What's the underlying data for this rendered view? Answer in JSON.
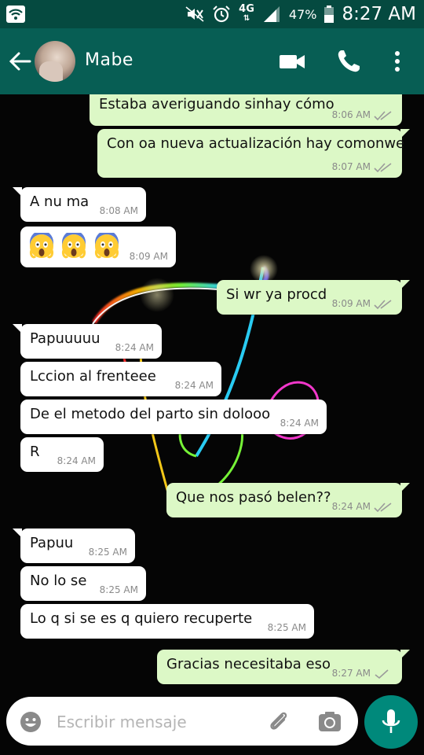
{
  "status_bar": {
    "network": "4G",
    "battery": "47%",
    "time": "8:27 AM"
  },
  "header": {
    "contact_name": "Mabe"
  },
  "messages": [
    {
      "direction": "out",
      "text": "Estaba averiguando sinhay cómo",
      "time": "8:06 AM",
      "status": "read"
    },
    {
      "direction": "out",
      "text": "Con oa nueva actualización hay comonwe",
      "time": "8:07 AM",
      "status": "read"
    },
    {
      "direction": "in",
      "text": "A nu ma",
      "time": "8:08 AM"
    },
    {
      "direction": "in",
      "emoji": [
        "face-screaming-in-fear",
        "face-screaming-in-fear",
        "face-screaming-in-fear"
      ],
      "time": "8:09 AM"
    },
    {
      "direction": "out",
      "text": "Si wr ya procd",
      "time": "8:09 AM",
      "status": "read"
    },
    {
      "direction": "in",
      "text": "Papuuuuu",
      "time": "8:24 AM"
    },
    {
      "direction": "in",
      "text": "Lccion al frenteee",
      "time": "8:24 AM"
    },
    {
      "direction": "in",
      "text": "De el metodo del parto  sin dolooo",
      "time": "8:24 AM"
    },
    {
      "direction": "in",
      "text": "R",
      "time": "8:24 AM"
    },
    {
      "direction": "out",
      "text": "Que nos pasó belen??",
      "time": "8:24 AM",
      "status": "read"
    },
    {
      "direction": "in",
      "text": "Papuu",
      "time": "8:25 AM"
    },
    {
      "direction": "in",
      "text": "No lo se",
      "time": "8:25 AM"
    },
    {
      "direction": "in",
      "text": "Lo q si se es q quiero recuperte",
      "time": "8:25 AM"
    },
    {
      "direction": "out",
      "text": "Gracias necesitaba eso",
      "time": "8:27 AM",
      "status": "delivered"
    }
  ],
  "composer": {
    "placeholder": "Escribir mensaje"
  },
  "colors": {
    "header": "#075e54",
    "status_bar": "#054a40",
    "outgoing_bubble": "#dcf8c6",
    "incoming_bubble": "#ffffff",
    "accent": "#00897b"
  }
}
